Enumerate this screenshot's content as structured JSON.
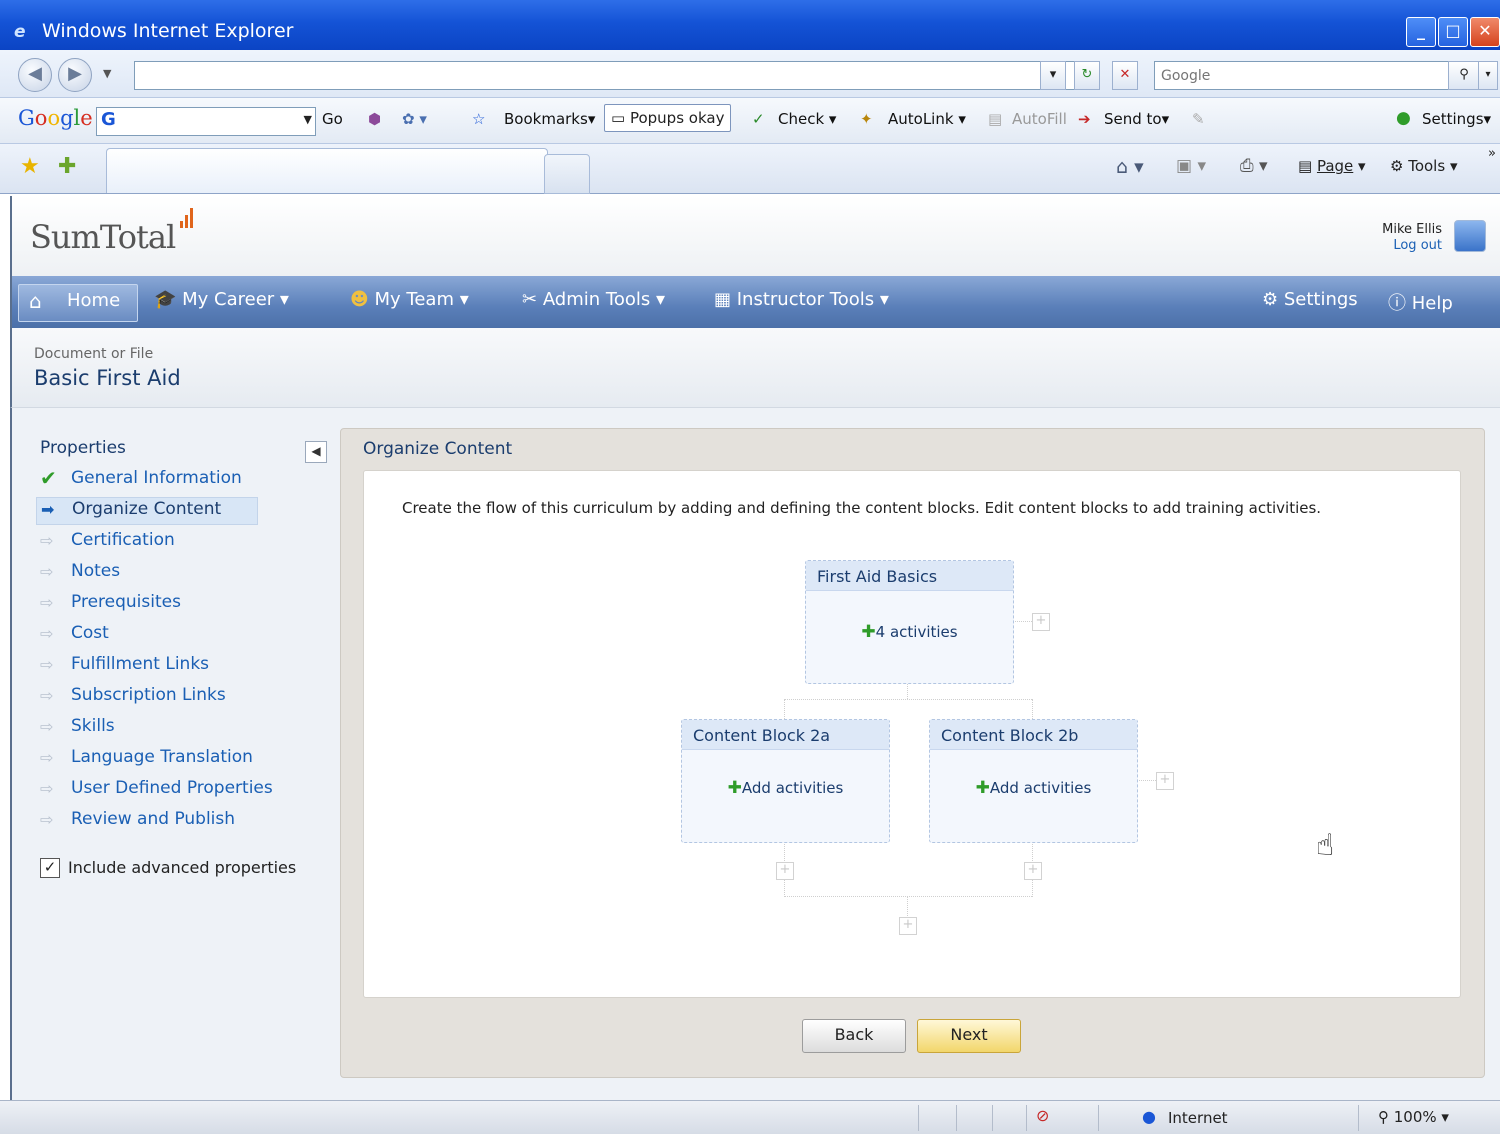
{
  "window": {
    "title": "Windows Internet Explorer"
  },
  "browser": {
    "address_value": "",
    "search_placeholder": "Google",
    "google_toolbar": {
      "go": "Go",
      "bookmarks": "Bookmarks",
      "popups": "Popups okay",
      "check": "Check",
      "autolink": "AutoLink",
      "autofill": "AutoFill",
      "sendto": "Send to",
      "settings": "Settings"
    },
    "command_bar": {
      "page": "Page",
      "tools": "Tools"
    }
  },
  "app": {
    "logo": "SumTotal",
    "user": {
      "name": "Mike Ellis",
      "logout": "Log out"
    },
    "nav": {
      "home": "Home",
      "my_career": "My Career",
      "my_team": "My Team",
      "admin_tools": "Admin Tools",
      "instructor_tools": "Instructor Tools",
      "settings": "Settings",
      "help": "Help"
    },
    "page": {
      "type": "Document or File",
      "title": "Basic First Aid"
    },
    "sidebar": {
      "title": "Properties",
      "items": [
        {
          "label": "General Information",
          "state": "done"
        },
        {
          "label": "Organize Content",
          "state": "active"
        },
        {
          "label": "Certification",
          "state": "todo"
        },
        {
          "label": "Notes",
          "state": "todo"
        },
        {
          "label": "Prerequisites",
          "state": "todo"
        },
        {
          "label": "Cost",
          "state": "todo"
        },
        {
          "label": "Fulfillment Links",
          "state": "todo"
        },
        {
          "label": "Subscription Links",
          "state": "todo"
        },
        {
          "label": "Skills",
          "state": "todo"
        },
        {
          "label": "Language Translation",
          "state": "todo"
        },
        {
          "label": "User Defined Properties",
          "state": "todo"
        },
        {
          "label": "Review and Publish",
          "state": "todo"
        }
      ],
      "advanced_label": "Include advanced properties"
    },
    "panel": {
      "title": "Organize Content",
      "instructions": "Create the flow of this curriculum by adding and defining the content blocks. Edit content blocks to add training activities.",
      "blocks": [
        {
          "title": "First Aid Basics",
          "action": "4 activities"
        },
        {
          "title": "Content Block 2a",
          "action": "Add activities"
        },
        {
          "title": "Content Block 2b",
          "action": "Add activities"
        }
      ],
      "back": "Back",
      "next": "Next"
    }
  },
  "status": {
    "zone": "Internet",
    "zoom": "100%"
  },
  "colors": {
    "title_bar": "#1453d6",
    "nav_bar": "#5a7fb9",
    "link": "#1a5fb4",
    "done_check": "#2f9c2a",
    "next_button": "#f2d66b"
  }
}
